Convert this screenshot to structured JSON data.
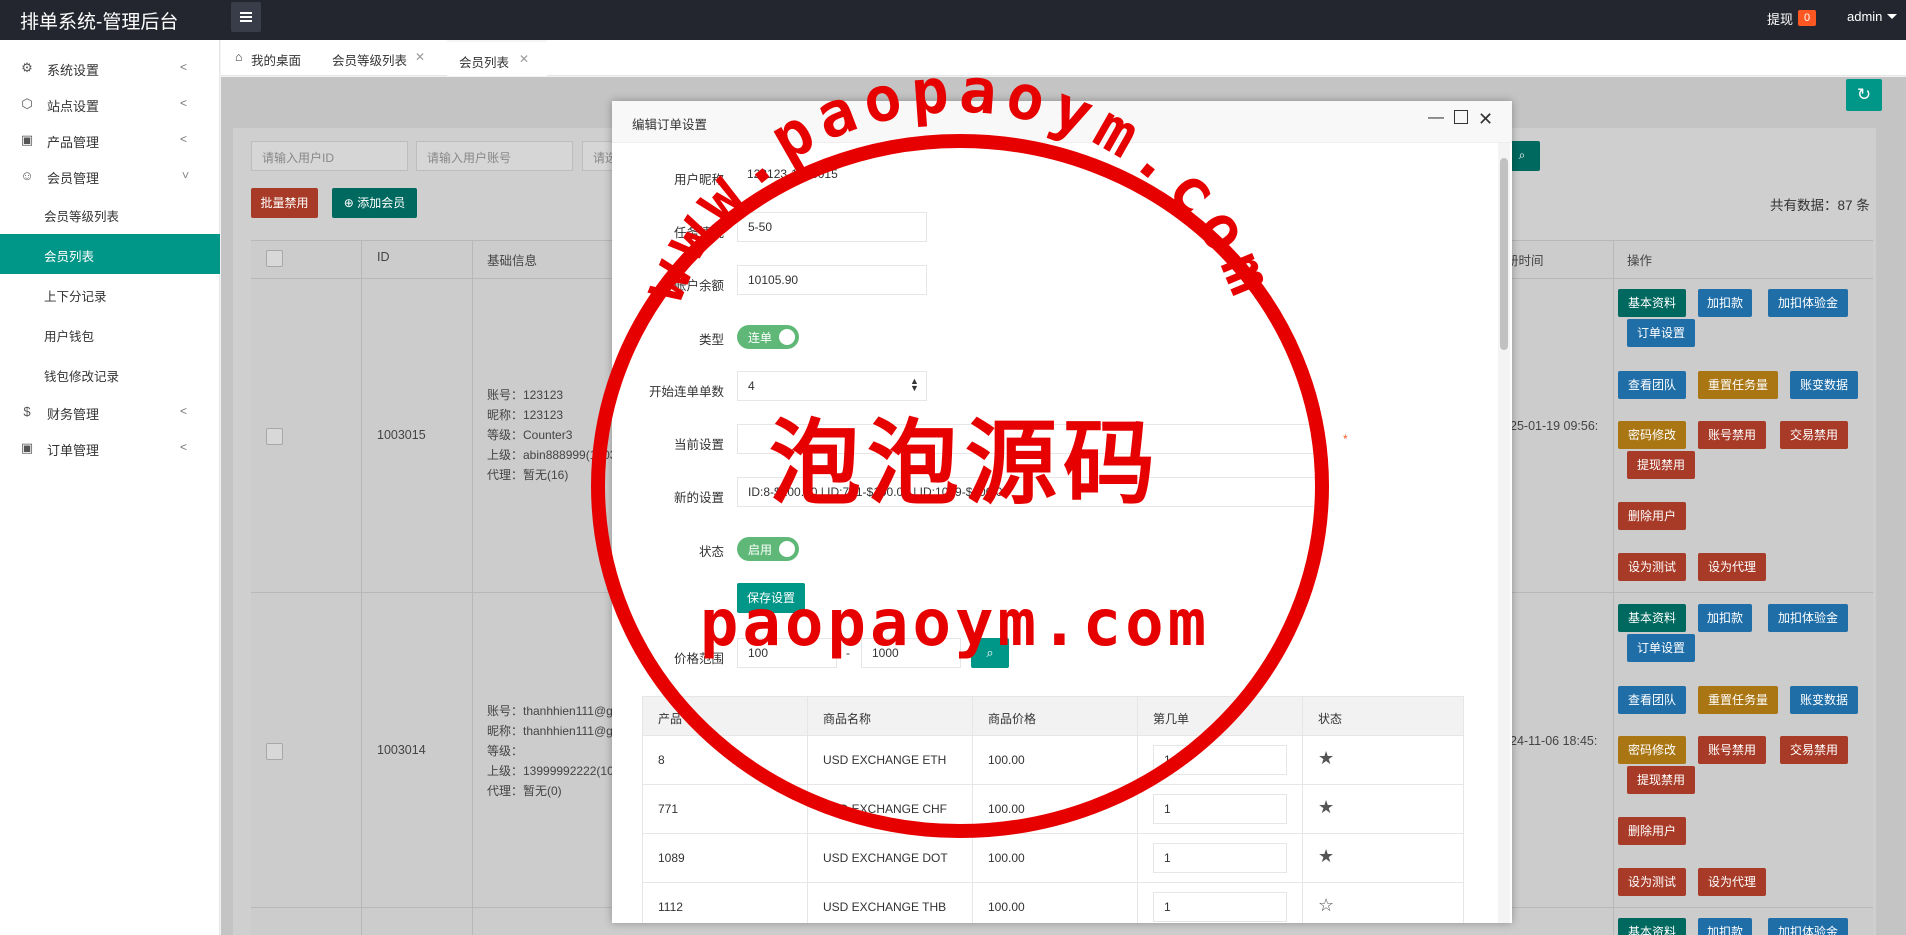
{
  "app": {
    "title": "排单系统-管理后台"
  },
  "header": {
    "withdraw_label": "提现",
    "withdraw_count": "0",
    "user": "admin"
  },
  "sidebar": {
    "items": [
      {
        "label": "系统设置"
      },
      {
        "label": "站点设置"
      },
      {
        "label": "产品管理"
      },
      {
        "label": "会员管理"
      },
      {
        "label": "财务管理"
      },
      {
        "label": "订单管理"
      }
    ],
    "sub_items": [
      {
        "label": "会员等级列表"
      },
      {
        "label": "会员列表"
      },
      {
        "label": "上下分记录"
      },
      {
        "label": "用户钱包"
      },
      {
        "label": "钱包修改记录"
      }
    ]
  },
  "tabs": [
    {
      "label": "我的桌面"
    },
    {
      "label": "会员等级列表"
    },
    {
      "label": "会员列表"
    }
  ],
  "search": {
    "user_id_placeholder": "请输入用户ID",
    "user_account_placeholder": "请输入用户账号",
    "third_partial": "请选"
  },
  "toolbar": {
    "batch_disable": "批量禁用",
    "add_member": "添加会员",
    "total": "共有数据：87 条"
  },
  "table": {
    "headers": [
      "ID",
      "基础信息",
      "册时间",
      "操作"
    ],
    "rows": [
      {
        "id": "1003015",
        "info": [
          "账号：123123",
          "昵称：123123",
          "等级：Counter3",
          "上级：abin888999(1003",
          "代理：暂无(16)"
        ],
        "time": "25-01-19 09:56:"
      },
      {
        "id": "1003014",
        "info": [
          "账号：thanhhien111@g",
          "昵称：thanhhien111@g",
          "等级：",
          "上级：13999992222(10",
          "代理：暂无(0)"
        ],
        "time": "24-11-06 18:45:"
      }
    ],
    "actions": {
      "basic": "基本资料",
      "add_deduct": "加扣款",
      "add_exp": "加扣体验金",
      "order_settings": "订单设置",
      "view_team": "查看团队",
      "reset_tasks": "重置任务量",
      "account_changes": "账变数据",
      "pwd_change": "密码修改",
      "disable_account": "账号禁用",
      "disable_trade": "交易禁用",
      "disable_withdraw": "提现禁用",
      "delete_user": "删除用户",
      "set_test": "设为测试",
      "set_agent": "设为代理"
    }
  },
  "modal": {
    "title": "编辑订单设置",
    "fields": {
      "nickname_label": "用户昵称",
      "nickname": "123123-1003015",
      "task_label": "任务情况",
      "task": "5-50",
      "balance_label": "账户余额",
      "balance": "10105.90",
      "type_label": "类型",
      "type_value": "连单",
      "start_label": "开始连单单数",
      "start": "4",
      "current_label": "当前设置",
      "current": "",
      "new_label": "新的设置",
      "new": "ID:8-$100.00 | ID:771-$100.00 | ID:1089-$100.00",
      "status_label": "状态",
      "status_value": "启用",
      "save": "保存设置",
      "price_label": "价格范围",
      "price_min": "100",
      "price_sep": "-",
      "price_max": "1000"
    },
    "table": {
      "headers": [
        "产品",
        "商品名称",
        "商品价格",
        "第几单",
        "状态"
      ],
      "rows": [
        {
          "id": "8",
          "name": "USD EXCHANGE ETH",
          "price": "100.00",
          "order": "1",
          "star": "★"
        },
        {
          "id": "771",
          "name": "USD EXCHANGE CHF",
          "price": "100.00",
          "order": "1",
          "star": "★"
        },
        {
          "id": "1089",
          "name": "USD EXCHANGE DOT",
          "price": "100.00",
          "order": "1",
          "star": "★"
        },
        {
          "id": "1112",
          "name": "USD EXCHANGE THB",
          "price": "100.00",
          "order": "1",
          "star": "☆"
        }
      ]
    }
  },
  "watermark": {
    "url_arc": "www.paopaoym.com",
    "chinese": "泡泡源码",
    "domain": "paopaoym.com"
  }
}
